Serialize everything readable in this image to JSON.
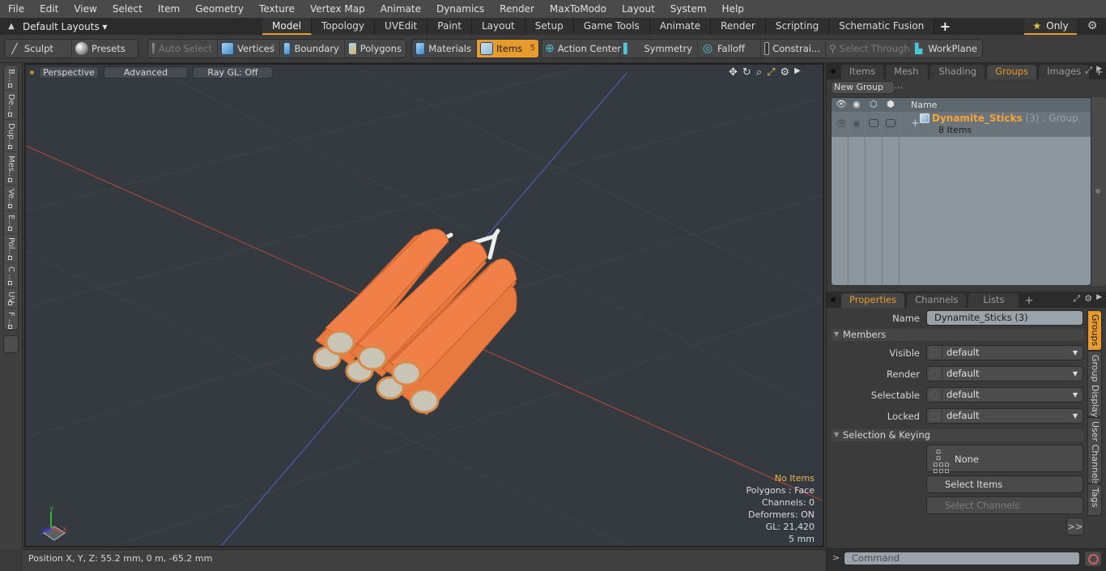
{
  "menubar": {
    "items": [
      "File",
      "Edit",
      "View",
      "Select",
      "Item",
      "Geometry",
      "Texture",
      "Vertex Map",
      "Animate",
      "Dynamics",
      "Render",
      "MaxToModo",
      "Layout",
      "System",
      "Help"
    ]
  },
  "layoutbar": {
    "layout_select": "Default Layouts ▾",
    "tabs": [
      "Model",
      "Topology",
      "UVEdit",
      "Paint",
      "Layout",
      "Setup",
      "Game Tools",
      "Animate",
      "Render",
      "Scripting",
      "Schematic Fusion"
    ],
    "active_tab": "Model",
    "add_tab": "+",
    "only_label": "Only",
    "star_icon": "★"
  },
  "toolbar": {
    "sculpt": "Sculpt",
    "presets": "Presets",
    "auto_select": "Auto Select",
    "vertices": "Vertices",
    "vertices_count": "1",
    "boundary": "Boundary",
    "polygons": "Polygons",
    "materials": "Materials",
    "items": "Items",
    "items_count": "5",
    "action_center": "Action Center",
    "symmetry": "Symmetry",
    "falloff": "Falloff",
    "constraints": "Constrai...",
    "select_through": "Select Through",
    "workplane": "WorkPlane"
  },
  "left_tabs": [
    "B...",
    "De...",
    "Dup...",
    "Mes...",
    "Ve...",
    "E...",
    "Pol...",
    "C ...",
    "UV",
    "F ..."
  ],
  "viewport": {
    "view_mode": "Perspective",
    "shading": "Advanced",
    "ray_gl": "Ray GL: Off",
    "info": {
      "items": "No Items",
      "polygons": "Polygons : Face",
      "channels": "Channels: 0",
      "deformers": "Deformers: ON",
      "gl": "GL: 21,420",
      "scale": "5 mm"
    },
    "axis": {
      "x": "X",
      "y": "Y",
      "z": "Z"
    },
    "colors": {
      "x_axis": "#c0473b",
      "z_axis": "#5a5fd0",
      "dynamite": "#e8793f"
    }
  },
  "statusbar": {
    "position": "Position X, Y, Z:   55.2 mm, 0 m, -65.2 mm"
  },
  "groups_panel": {
    "tabs": [
      "Items",
      "Mesh ...",
      "Shading",
      "Groups",
      "Images"
    ],
    "active_tab": "Groups",
    "add_tab": "+",
    "new_group": "New Group",
    "columns": {
      "name": "Name"
    },
    "rows": [
      {
        "name": "Dynamite_Sticks",
        "count": " (3)",
        "type": " : Group",
        "items": "8 Items",
        "expand": "+"
      }
    ]
  },
  "properties_panel": {
    "tabs": [
      "Properties",
      "Channels",
      "Lists"
    ],
    "active_tab": "Properties",
    "add_tab": "+",
    "name_label": "Name",
    "name_value": "Dynamite_Sticks (3)",
    "members_section": "Members",
    "fields": [
      {
        "label": "Visible",
        "value": "default"
      },
      {
        "label": "Render",
        "value": "default"
      },
      {
        "label": "Selectable",
        "value": "default"
      },
      {
        "label": "Locked",
        "value": "default"
      }
    ],
    "selection_section": "Selection & Keying",
    "none_button": "None",
    "select_items": "Select Items",
    "select_channels": "Select Channels",
    "more_button": ">>",
    "side_tabs": [
      "Groups",
      "Group Display",
      "User Channels",
      "Tags"
    ],
    "active_side_tab": "Groups"
  },
  "command": {
    "prompt": ">",
    "placeholder": "Command"
  },
  "colors": {
    "accent": "#e89a2c",
    "group_name": "#f3a43b",
    "info_highlight": "#e8b84a"
  }
}
